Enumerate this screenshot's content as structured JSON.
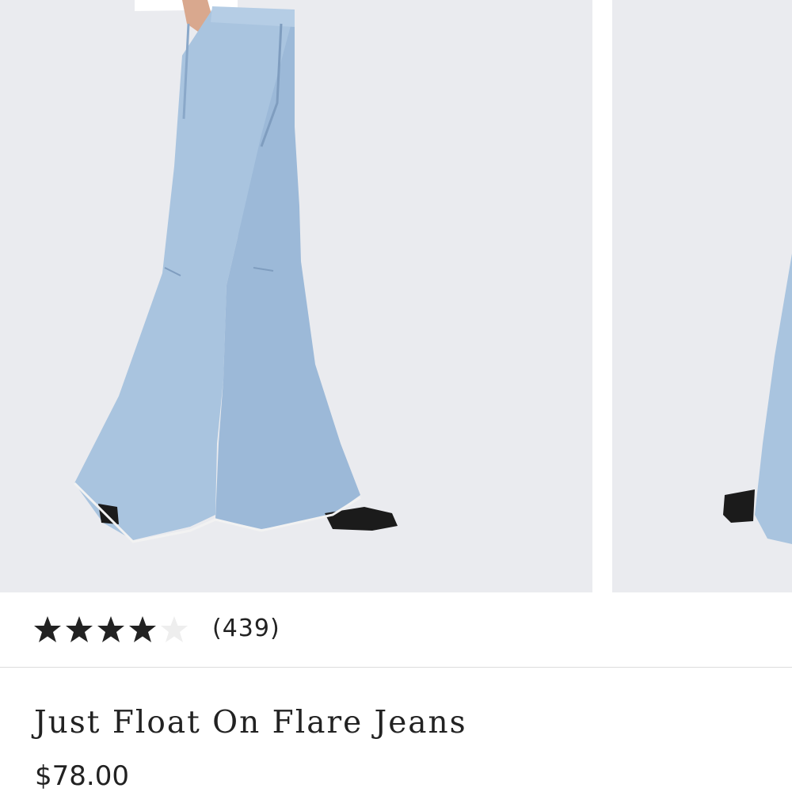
{
  "product": {
    "title": "Just Float On Flare Jeans",
    "price": "$78.00",
    "rating": 4.5,
    "rating_max": 5,
    "review_count": "(439)"
  },
  "gallery": {
    "images": [
      {
        "subject": "model-wearing-light-wash-flare-jeans-front"
      },
      {
        "subject": "model-wearing-light-wash-flare-jeans-partial"
      }
    ]
  },
  "colors": {
    "image_background": "#eaebef",
    "denim": "#a9c4df",
    "text": "#222222",
    "star": "#222222",
    "divider": "#dcdcdc"
  }
}
